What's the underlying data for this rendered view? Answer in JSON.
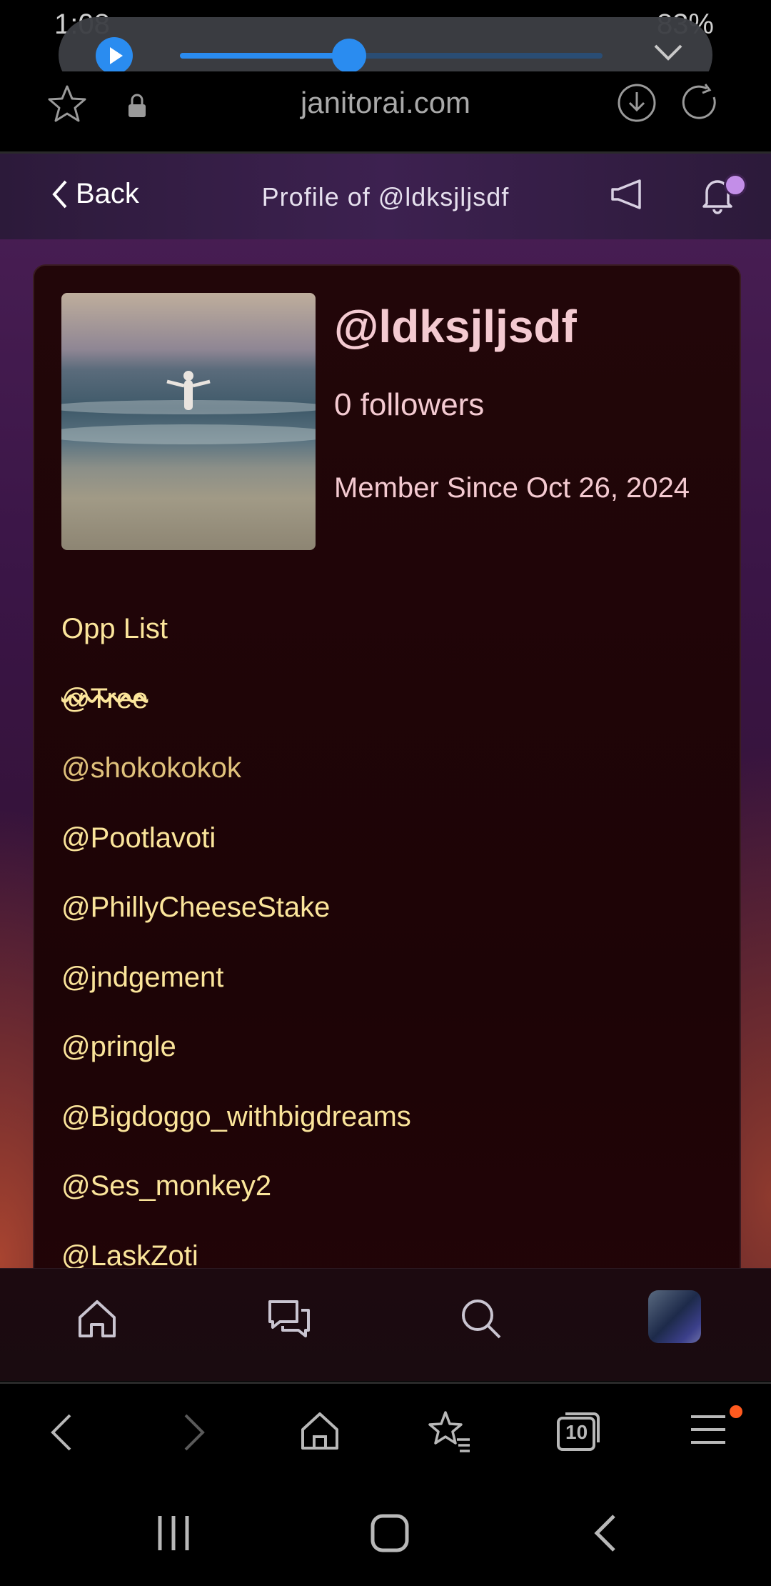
{
  "status_bar": {
    "time": "1:08",
    "battery": "83%"
  },
  "media_player": {
    "progress": 0.4
  },
  "browser": {
    "url": "janitorai.com",
    "tab_count": "10"
  },
  "header": {
    "back_label": "Back",
    "title": "Profile of @ldksjljsdf"
  },
  "profile": {
    "username": "@ldksjljsdf",
    "followers": "0 followers",
    "member_since": "Member Since Oct 26, 2024"
  },
  "bio": {
    "heading": "Opp List",
    "entries": [
      "@Tree",
      "@shokokokok",
      "@Pootlavoti",
      "@PhillyCheeseStake",
      "@jndgement",
      "@pringle",
      "@Bigdoggo_withbigdreams",
      "@Ses_monkey2",
      "@LaskZoti"
    ]
  },
  "colors": {
    "accent_text": "#f4cad1",
    "bio_text": "#fbe59b",
    "notification_dot": "#c38ee8",
    "menu_badge": "#ff5a1f",
    "media_blue": "#2a8cf0"
  }
}
